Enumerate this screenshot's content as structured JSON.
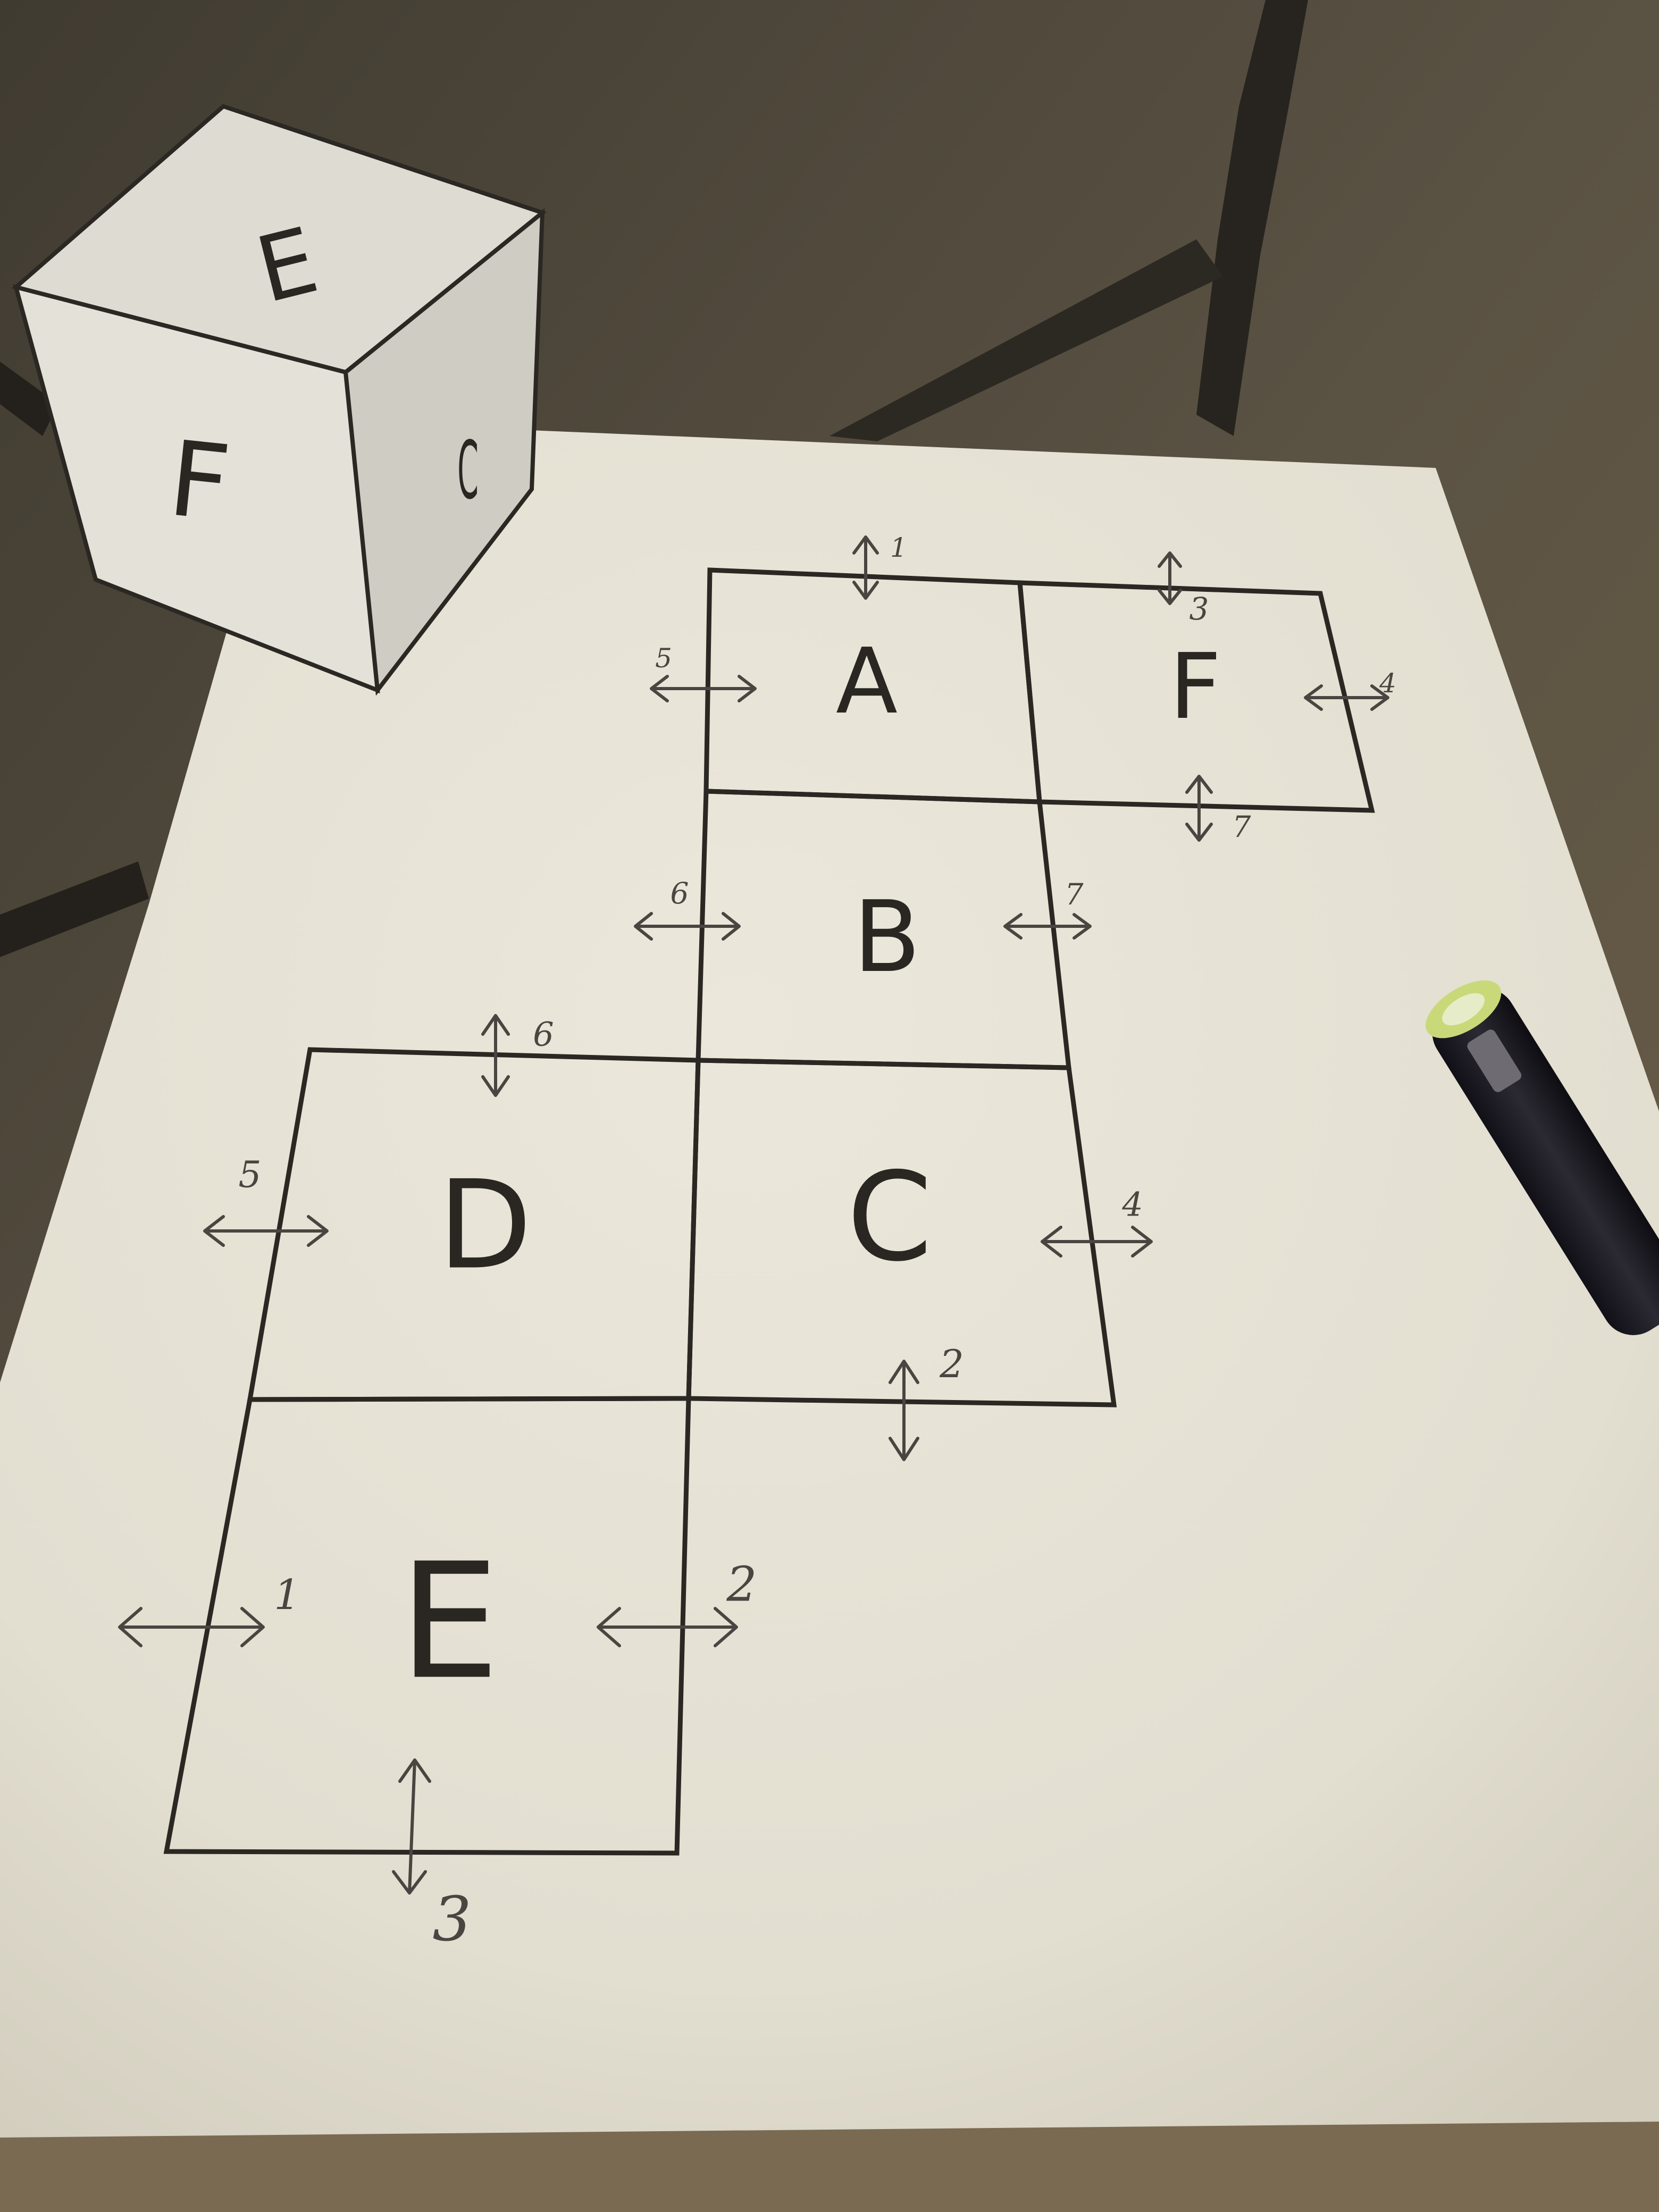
{
  "colors": {
    "floor": "#4a4439",
    "paper": "#e6e2d5",
    "ink": "#2b2723",
    "pencil": "#4a4540",
    "cube_front": "#e4e1d8",
    "cube_top": "#dedbd2",
    "cube_side": "#cfccc3",
    "chair": "#2a2724",
    "marker_body": "#1c1b22",
    "marker_cap": "#c9d97a"
  },
  "cube": {
    "top_label": "E",
    "front_label": "F",
    "side_label": "C"
  },
  "net": {
    "faces": [
      {
        "id": "A",
        "label": "A"
      },
      {
        "id": "F",
        "label": "F"
      },
      {
        "id": "B",
        "label": "B"
      },
      {
        "id": "D",
        "label": "D"
      },
      {
        "id": "C",
        "label": "C"
      },
      {
        "id": "E",
        "label": "E"
      }
    ]
  },
  "edge_numbers": {
    "a_top": "1",
    "a_left": "5",
    "f_top": "3",
    "f_right": "4",
    "f_bottom": "7",
    "b_left": "6",
    "b_right": "7",
    "d_top": "6",
    "d_left": "5",
    "c_right": "4",
    "c_bottom": "2",
    "e_left": "1",
    "e_right": "2",
    "e_bottom": "3"
  },
  "icons": {
    "marker": "marker-pen-icon",
    "arrow": "double-arrow-icon"
  }
}
